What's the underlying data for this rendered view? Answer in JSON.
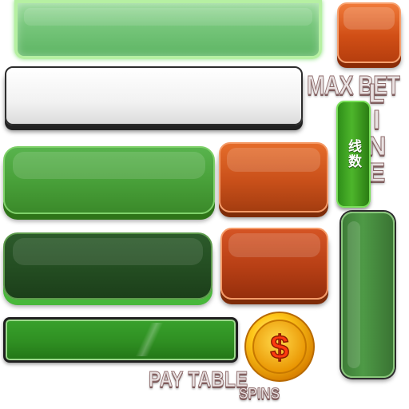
{
  "labels": {
    "max_bet": "MAX BET",
    "line": "LINE",
    "lines_cn": "线数",
    "pay_table": "PAY TABLE",
    "spins": "SPINS"
  },
  "coin": {
    "symbol": "$"
  },
  "colors": {
    "green_light": "#78c77c",
    "green": "#49a13a",
    "green_dark": "#244e22",
    "orange": "#c9501a",
    "gold": "#f5a800",
    "white_bar": "#f2f2f2"
  }
}
